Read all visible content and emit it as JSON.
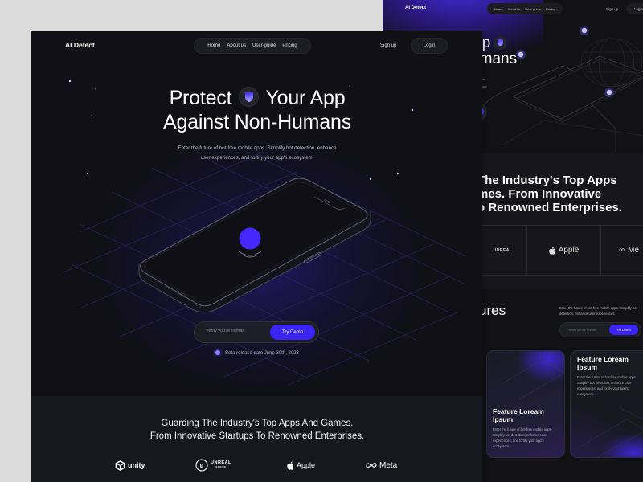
{
  "front": {
    "nav": {
      "logo": "AI Detect",
      "links": [
        "Home",
        "About us",
        "User-guide",
        "Pricing"
      ],
      "signup": "Sign up",
      "login": "Login"
    },
    "hero": {
      "title_line1_left": "Protect",
      "title_line1_right": "Your App",
      "title_line2": "Against Non-Humans",
      "subtitle_line1": "Enter the future of bot-free mobile apps. Simplify bot detection, enhance",
      "subtitle_line2": "user experiences, and fortify your app's ecosystem.",
      "input_placeholder": "Verify you're human",
      "cta": "Try Demo",
      "beta_note": "Beta release date June 30th, 2023",
      "icon": "shield-icon"
    },
    "partners": {
      "title_line1": "Guarding The Industry's Top Apps And Games.",
      "title_line2": "From Innovative Startups To Renowned Enterprises.",
      "logos": [
        {
          "name": "unity",
          "label": "unity",
          "icon": "unity-logo-icon"
        },
        {
          "name": "unreal",
          "label": "UNREAL",
          "sublabel": "ENGINE",
          "icon": "unreal-logo-icon"
        },
        {
          "name": "apple",
          "label": "Apple",
          "icon": "apple-logo-icon"
        },
        {
          "name": "meta",
          "label": "Meta",
          "icon": "meta-logo-icon"
        }
      ]
    }
  },
  "back": {
    "nav": {
      "logo": "AI Detect",
      "links": [
        "Home",
        "About us",
        "User-guide",
        "Pricing"
      ],
      "signup": "Sign up",
      "login": "Login"
    },
    "hero": {
      "title_line1": "r App",
      "title_line2": "-Humans",
      "small_line1": "ot",
      "small_line2": "our"
    },
    "partners": {
      "heading_line1": "The Industry's Top Apps",
      "heading_line2": "mes. From Innovative",
      "heading_line3": "o Renowned Enterprises.",
      "logos": [
        "UNREAL",
        "Apple",
        "Me"
      ]
    },
    "features": {
      "title": "ures",
      "desc": "Enter the future of bot-free mobile apps. Simplify bot detection, enhance user experiences.",
      "input_placeholder": "Verify you're human",
      "cta": "Try Demo",
      "cards": [
        {
          "title": "Feature Loream Ipsum",
          "text": "Enter the future of bot-free mobile apps. Simplify bot detection, enhance user experiences, and fortify your app's ecosystem."
        },
        {
          "title": "Feature Loream Ipsum",
          "text": "Enter the future of bot-free mobile apps. Simplify bot detection, enhance user experiences, and fortify your app's ecosystem."
        }
      ]
    }
  },
  "colors": {
    "accent": "#3a24f6",
    "background": "#101016",
    "canvas": "#dcdcdc",
    "section": "#17171e"
  }
}
